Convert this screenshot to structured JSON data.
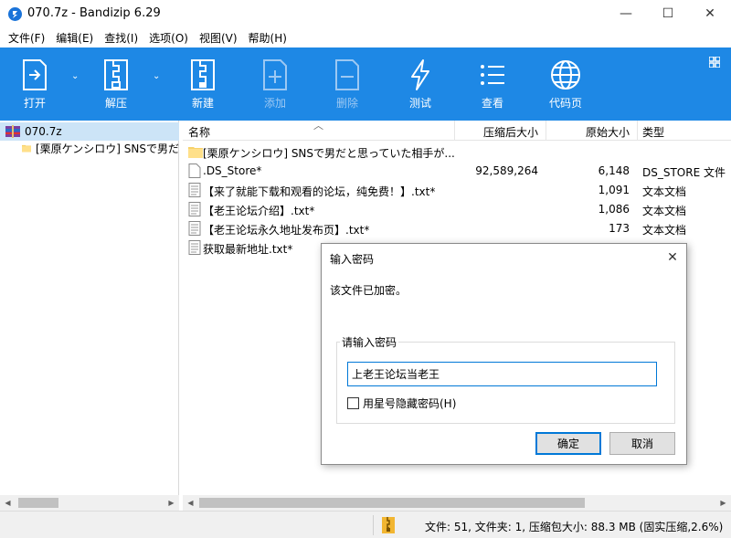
{
  "window": {
    "title": "070.7z - Bandizip 6.29",
    "minimize": "—",
    "maximize": "☐",
    "close": "✕"
  },
  "menu": [
    "文件(F)",
    "编辑(E)",
    "查找(I)",
    "选项(O)",
    "视图(V)",
    "帮助(H)"
  ],
  "toolbar": {
    "open": "打开",
    "extract": "解压",
    "new": "新建",
    "add": "添加",
    "delete": "删除",
    "test": "测试",
    "view": "查看",
    "codepage": "代码页",
    "dropdown_glyph": "⌄"
  },
  "tree": {
    "root": "070.7z",
    "child": "[栗原ケンシロウ] SNSで男だ"
  },
  "list": {
    "headers": {
      "name": "名称",
      "compressed": "压缩后大小",
      "original": "原始大小",
      "type": "类型",
      "sort_glyph": "︿"
    },
    "rows": [
      {
        "icon": "folder",
        "name": "[栗原ケンシロウ] SNSで男だと思っていた相手が...",
        "compressed": "",
        "original": "",
        "type": ""
      },
      {
        "icon": "file",
        "name": ".DS_Store*",
        "compressed": "92,589,264",
        "original": "6,148",
        "type": "DS_STORE 文件"
      },
      {
        "icon": "text",
        "name": "【来了就能下载和观看的论坛，纯免费！】.txt*",
        "compressed": "",
        "original": "1,091",
        "type": "文本文档"
      },
      {
        "icon": "text",
        "name": "【老王论坛介绍】.txt*",
        "compressed": "",
        "original": "1,086",
        "type": "文本文档"
      },
      {
        "icon": "text",
        "name": "【老王论坛永久地址发布页】.txt*",
        "compressed": "",
        "original": "173",
        "type": "文本文档"
      },
      {
        "icon": "text",
        "name": "获取最新地址.txt*",
        "compressed": "",
        "original": "",
        "type": ""
      }
    ]
  },
  "statusbar": {
    "text": "文件: 51, 文件夹: 1, 压缩包大小: 88.3 MB (固实压缩,2.6%)"
  },
  "dialog": {
    "title": "输入密码",
    "close": "✕",
    "message": "该文件已加密。",
    "group_label": "请输入密码",
    "password_value": "上老王论坛当老王",
    "checkbox_label": "用星号隐藏密码(H)",
    "ok": "确定",
    "cancel": "取消"
  },
  "scrollbars": {
    "left_arrow": "◀",
    "right_arrow": "▶"
  },
  "colors": {
    "toolbar": "#1e88e5",
    "selection": "#cce4f7",
    "accent": "#0078d7"
  }
}
